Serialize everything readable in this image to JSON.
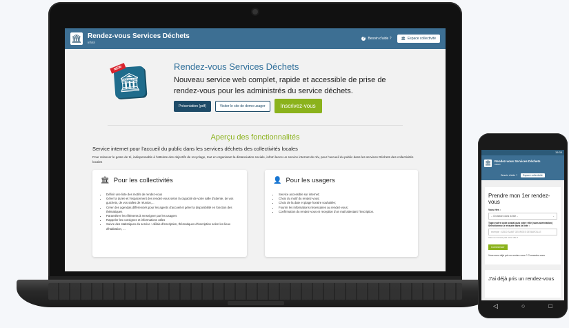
{
  "app": {
    "title": "Rendez-vous Services Déchets",
    "subtitle": "infotri",
    "help_label": "Besoin d'aide ?",
    "space_label": "Espace collectivité"
  },
  "hero": {
    "ribbon": "NEW",
    "title": "Rendez-vous Services Déchets",
    "tagline": "Nouveau service web complet, rapide et accessible de prise de rendez-vous pour les administrés du service déchets.",
    "buttons": {
      "presentation": "Présentation (pdf)",
      "demo": "Visiter le site de demo usager",
      "signup": "Inscrivez-vous"
    }
  },
  "features": {
    "title": "Aperçu des fonctionnalités",
    "subtitle": "Service internet pour l'accueil du public dans les services déchets des collectivités locales",
    "description": "Pour relancer le geste de tri, indispensable à l'atteinte des objectifs de recyclage, tout en organisant la distanciation sociale, infotri lance un service internet de rdv, pour l'accueil du public dans les services Déchets des collectivités locales"
  },
  "cards": {
    "collectivites": {
      "title": "Pour les collectivités",
      "items": [
        "Définir une liste des motifs de rendez-vous",
        "Gérer la durée et l'espacement des rendez-vous selon la capacité de votre salle d'attente, de vos guichets, de vos salles de réunion,...",
        "Créer des agendas différenciés pour les agents d'accueil et gérer la disponibilité en fonction des thématiques",
        "Paramétrer les éléments à renseigner par les usagers",
        "Rappeler les consignes et informations utiles",
        "Suivre des statistiques du service : délais d'inscription, thématiques d'inscription selon les lieux d'habitation, ..."
      ]
    },
    "usagers": {
      "title": "Pour les usagers",
      "items": [
        "Service accessible sur internet;",
        "Choix du motif du rendez-vous;",
        "Choix de la date et plage horaire souhaitée;",
        "Fournir les informations nécessaires au rendez-vous;",
        "Confirmation du rendez-vous et reception d'un mail attestant l'inscription."
      ]
    }
  },
  "phone": {
    "time": "15:35",
    "app_title": "Rendez-vous Services Déchets",
    "app_sub": "infotri",
    "help_label": "Besoin d'aide ?",
    "space_label": "Espace collectivité",
    "card_title": "Prendre mon 1er rendez-vous",
    "you_are_label": "Vous êtes :",
    "select_value": "-- Choisissez dans la liste --",
    "postal_label": "Tapez votre code postal puis votre ville (sans abréviation) Sélectionnez-le ensuite dans la liste :",
    "postal_placeholder": "exemple : 42510 SAINT GEORGES DE BAROILLE",
    "postal_hint": "Vous ne trouvez pas votre ville ?",
    "start_button": "Commencer",
    "already_text": "Vous avez déjà pris un rendez-vous ? Connectez-vous",
    "card2_title": "J'ai déjà pris un rendez-vous"
  }
}
